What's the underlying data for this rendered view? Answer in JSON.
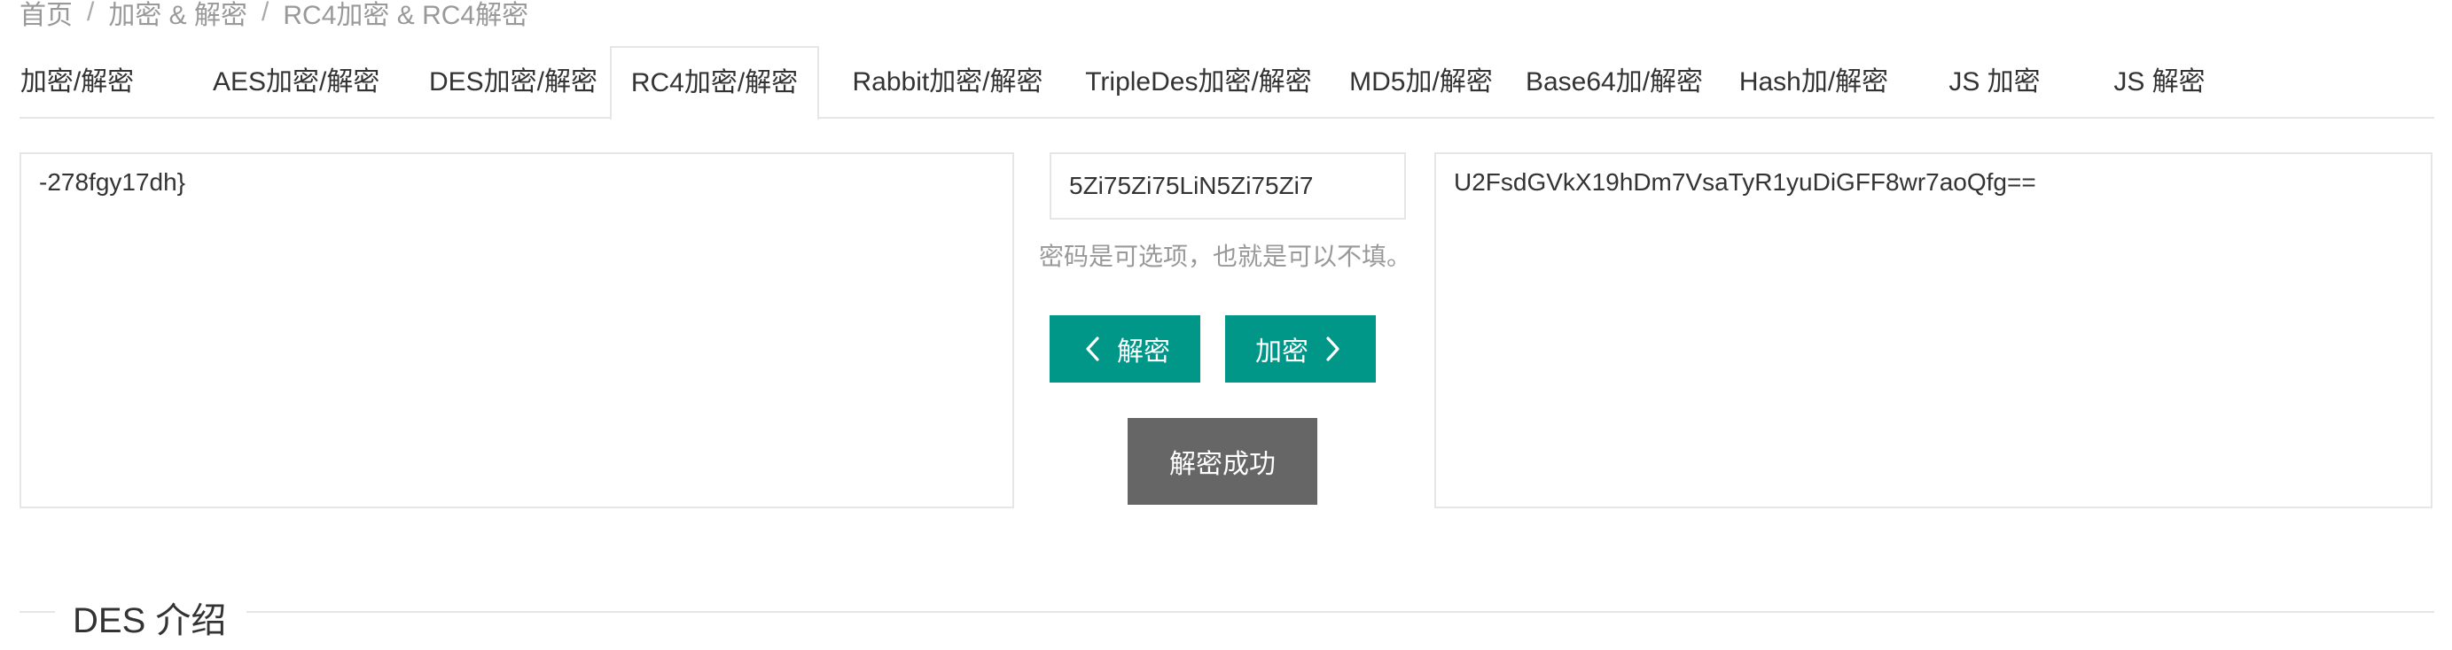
{
  "breadcrumb": {
    "home": "首页",
    "category": "加密 & 解密",
    "current": "RC4加密 & RC4解密",
    "separator": "/"
  },
  "tabs": [
    {
      "label": "加密/解密"
    },
    {
      "label": "AES加密/解密"
    },
    {
      "label": "DES加密/解密"
    },
    {
      "label": "RC4加密/解密",
      "active": true
    },
    {
      "label": "Rabbit加密/解密"
    },
    {
      "label": "TripleDes加密/解密"
    },
    {
      "label": "MD5加/解密"
    },
    {
      "label": "Base64加/解密"
    },
    {
      "label": "Hash加/解密"
    },
    {
      "label": "JS 加密"
    },
    {
      "label": "JS 解密"
    }
  ],
  "editor": {
    "plaintext": "-278fgy17dh}",
    "ciphertext": "U2FsdGVkX19hDm7VsaTyR1yuDiGFF8wr7aoQfg==",
    "password": "5Zi75Zi75LiN5Zi75Zi7",
    "password_hint": "密码是可选项，也就是可以不填。",
    "decrypt_label": "解密",
    "encrypt_label": "加密",
    "status_label": "解密成功"
  },
  "section": {
    "title": "DES 介绍"
  },
  "colors": {
    "accent": "#009688",
    "status_bg": "#666666",
    "border": "#e6e6e6",
    "muted_text": "#999999"
  },
  "icons": {
    "decrypt": "chevron-left-icon",
    "encrypt": "chevron-right-icon"
  }
}
